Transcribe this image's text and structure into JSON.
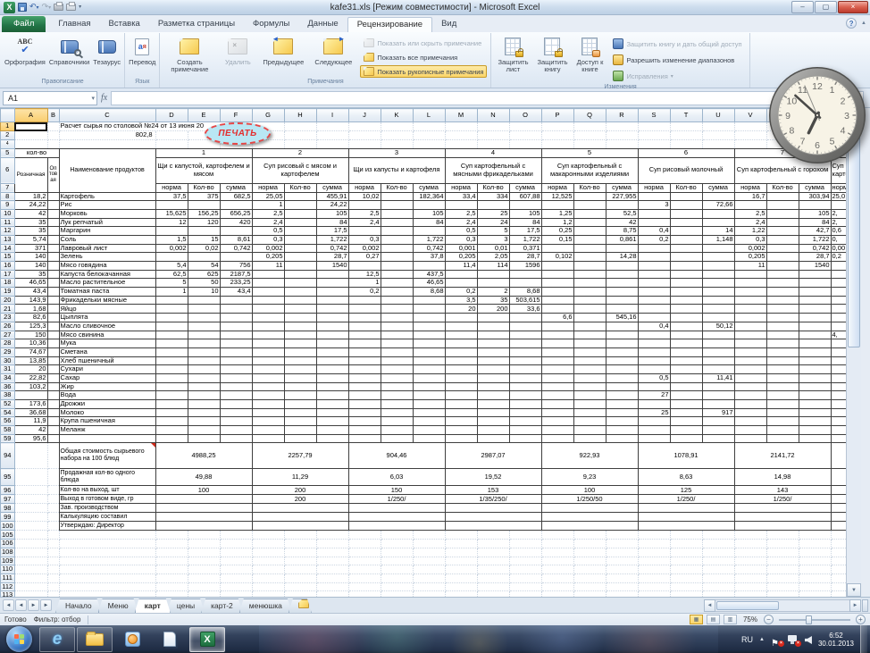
{
  "window": {
    "title": "kafe31.xls  [Режим совместимости]  -  Microsoft Excel"
  },
  "glyphs": {
    "min": "–",
    "max": "▢",
    "close": "×",
    "dd": "▾",
    "undo": "↶",
    "redo": "↷",
    "abc": "ABC",
    "check": "✔",
    "a": "а",
    "ya": "я",
    "up": "▲",
    "down": "▼",
    "left": "◄",
    "right": "►",
    "first": "◄◄",
    "last": "►►",
    "help": "?",
    "chev": "▲",
    "minus": "−",
    "plus": "+",
    "fx": "fx",
    "flag": "⚑",
    "x": "×",
    "ie": "e",
    "excel": "X"
  },
  "tabs": {
    "file": "Файл",
    "items": [
      "Главная",
      "Вставка",
      "Разметка страницы",
      "Формулы",
      "Данные",
      "Рецензирование",
      "Вид"
    ]
  },
  "ribbon": {
    "group_labels": [
      "Правописание",
      "Язык",
      "Примечания",
      "Изменения"
    ],
    "spelling": "Орфография",
    "reference": "Справочники",
    "thesaurus": "Тезаурус",
    "translate": "Перевод",
    "new_comment": "Создать примечание",
    "delete_comment": "Удалить",
    "previous": "Предыдущее",
    "next": "Следующее",
    "toggle_show_hide": "Показать или скрыть примечание",
    "toggle_show_all": "Показать все примечания",
    "toggle_show_ink": "Показать рукописные примечания",
    "protect_sheet": "Защитить лист",
    "protect_book": "Защитить книгу",
    "share_book": "Доступ к книге",
    "protect_share": "Защитить книгу и дать общий доступ",
    "allow_ranges": "Разрешить изменение диапазонов",
    "track_changes": "Исправления"
  },
  "formula_bar": {
    "name_box": "A1",
    "formula": ""
  },
  "sheet": {
    "columns": [
      "A",
      "B",
      "C",
      "D",
      "E",
      "F",
      "G",
      "H",
      "I",
      "J",
      "K",
      "L",
      "M",
      "N",
      "O",
      "P",
      "Q",
      "R",
      "S",
      "T",
      "U",
      "V",
      "W",
      "X",
      "Y"
    ],
    "title1": "Расчет сырья по столовой №24 от 13 июня 20",
    "title2": "802,8",
    "print_button": "ПЕЧАТЬ",
    "hdr_kolvo": "кол-во",
    "hdr_retail": "Розничная",
    "hdr_opt": "Оптовая",
    "hdr_name": "Наименование продуктов",
    "subcols": [
      "норма",
      "Кол-во",
      "сумма"
    ],
    "dishes": [
      {
        "num": "1",
        "name": "Щи с капустой, картофелем и мясом"
      },
      {
        "num": "2",
        "name": "Суп рисовый с мясом и картофелем"
      },
      {
        "num": "3",
        "name": "Щи из капусты и картофеля"
      },
      {
        "num": "4",
        "name": "Суп картофельный с мясными фрикадельками"
      },
      {
        "num": "5",
        "name": "Суп картофельный с макаронными изделиями"
      },
      {
        "num": "6",
        "name": "Суп рисовый молочный"
      },
      {
        "num": "7",
        "name": "Суп картофельный с горохом"
      }
    ],
    "dish_partial": "Суп картоф",
    "sub_partial": "норма",
    "rows": [
      {
        "n": "8",
        "a": "18,2",
        "c": "Картофель",
        "v": {
          "D": "37,5",
          "E": "375",
          "F": "682,5",
          "G": "25,05",
          "I": "455,91",
          "J": "10,02",
          "L": "182,364",
          "M": "33,4",
          "N": "334",
          "O": "607,88",
          "P": "12,525",
          "R": "227,955",
          "V": "16,7",
          "X": "303,94",
          "Y": "25,0"
        }
      },
      {
        "n": "9",
        "a": "24,22",
        "c": "Рис",
        "v": {
          "G": "1",
          "I": "24,22",
          "S": "3",
          "U": "72,66"
        }
      },
      {
        "n": "10",
        "a": "42",
        "c": "Морковь",
        "v": {
          "D": "15,625",
          "E": "156,25",
          "F": "656,25",
          "G": "2,5",
          "I": "105",
          "J": "2,5",
          "L": "105",
          "M": "2,5",
          "N": "25",
          "O": "105",
          "P": "1,25",
          "R": "52,5",
          "V": "2,5",
          "X": "105",
          "Y": "2,"
        }
      },
      {
        "n": "11",
        "a": "35",
        "c": "Лук репчатый",
        "v": {
          "D": "12",
          "E": "120",
          "F": "420",
          "G": "2,4",
          "I": "84",
          "J": "2,4",
          "L": "84",
          "M": "2,4",
          "N": "24",
          "O": "84",
          "P": "1,2",
          "R": "42",
          "V": "2,4",
          "X": "84",
          "Y": "2,"
        }
      },
      {
        "n": "12",
        "a": "35",
        "c": "Маргарин",
        "v": {
          "G": "0,5",
          "I": "17,5",
          "M": "0,5",
          "N": "5",
          "O": "17,5",
          "P": "0,25",
          "R": "8,75",
          "S": "0,4",
          "U": "14",
          "V": "1,22",
          "X": "42,7",
          "Y": "0,6"
        }
      },
      {
        "n": "13",
        "a": "5,74",
        "c": "Соль",
        "v": {
          "D": "1,5",
          "E": "15",
          "F": "8,61",
          "G": "0,3",
          "I": "1,722",
          "J": "0,3",
          "L": "1,722",
          "M": "0,3",
          "N": "3",
          "O": "1,722",
          "P": "0,15",
          "R": "0,861",
          "S": "0,2",
          "U": "1,148",
          "V": "0,3",
          "X": "1,722",
          "Y": "0,"
        }
      },
      {
        "n": "14",
        "a": "371",
        "c": "Лавровый лист",
        "v": {
          "D": "0,002",
          "E": "0,02",
          "F": "0,742",
          "G": "0,002",
          "I": "0,742",
          "J": "0,002",
          "L": "0,742",
          "M": "0,001",
          "N": "0,01",
          "O": "0,371",
          "V": "0,002",
          "X": "0,742",
          "Y": "0,00"
        }
      },
      {
        "n": "15",
        "a": "140",
        "c": "Зелень",
        "v": {
          "G": "0,205",
          "I": "28,7",
          "J": "0,27",
          "L": "37,8",
          "M": "0,205",
          "N": "2,05",
          "O": "28,7",
          "P": "0,102",
          "R": "14,28",
          "V": "0,205",
          "X": "28,7",
          "Y": "0,2"
        }
      },
      {
        "n": "16",
        "a": "140",
        "c": "Мясо говядина",
        "v": {
          "D": "5,4",
          "E": "54",
          "F": "756",
          "G": "11",
          "I": "1540",
          "M": "11,4",
          "N": "114",
          "O": "1596",
          "V": "11",
          "X": "1540"
        }
      },
      {
        "n": "17",
        "a": "35",
        "c": "Капуста белокачанная",
        "v": {
          "D": "62,5",
          "E": "625",
          "F": "2187,5",
          "J": "12,5",
          "L": "437,5"
        }
      },
      {
        "n": "18",
        "a": "46,65",
        "c": "Масло растительное",
        "v": {
          "D": "5",
          "E": "50",
          "F": "233,25",
          "J": "1",
          "L": "46,65"
        }
      },
      {
        "n": "19",
        "a": "43,4",
        "c": "Томатная паста",
        "v": {
          "D": "1",
          "E": "10",
          "F": "43,4",
          "J": "0,2",
          "L": "8,68",
          "M": "0,2",
          "N": "2",
          "O": "8,68"
        }
      },
      {
        "n": "20",
        "a": "143,9",
        "c": "Фрикадельки мясные",
        "v": {
          "M": "3,5",
          "N": "35",
          "O": "503,615"
        }
      },
      {
        "n": "21",
        "a": "1,68",
        "c": "Яйцо",
        "v": {
          "M": "20",
          "N": "200",
          "O": "33,6"
        }
      },
      {
        "n": "23",
        "a": "82,6",
        "c": "Цыплята",
        "v": {
          "P": "6,6",
          "R": "545,16"
        }
      },
      {
        "n": "26",
        "a": "125,3",
        "c": "Масло сливочное",
        "v": {
          "S": "0,4",
          "U": "50,12"
        }
      },
      {
        "n": "27",
        "a": "150",
        "c": "Мясо свинина",
        "v": {
          "Y": "4,"
        }
      },
      {
        "n": "28",
        "a": "10,36",
        "c": "Мука",
        "v": {}
      },
      {
        "n": "29",
        "a": "74,67",
        "c": "Сметана",
        "v": {}
      },
      {
        "n": "30",
        "a": "13,85",
        "c": "Хлеб пшеничный",
        "v": {}
      },
      {
        "n": "31",
        "a": "20",
        "c": "Сухари",
        "v": {}
      },
      {
        "n": "34",
        "a": "22,82",
        "c": "Сахар",
        "v": {
          "S": "0,5",
          "U": "11,41"
        }
      },
      {
        "n": "36",
        "a": "103,2",
        "c": "Жир",
        "v": {}
      },
      {
        "n": "38",
        "a": "",
        "c": "Вода",
        "v": {
          "S": "27"
        }
      },
      {
        "n": "52",
        "a": "173,6",
        "c": "Дрожжи",
        "v": {}
      },
      {
        "n": "54",
        "a": "36,68",
        "c": "Молоко",
        "v": {
          "S": "25",
          "U": "917"
        }
      },
      {
        "n": "56",
        "a": "11,9",
        "c": "Крупа пшеничная",
        "v": {}
      },
      {
        "n": "58",
        "a": "42",
        "c": "Меланж",
        "v": {}
      },
      {
        "n": "59",
        "a": "95,6",
        "c": "",
        "v": {}
      }
    ],
    "summary_rows": [
      {
        "n": "94",
        "h": 29,
        "label": "Общая стоимость сырьевого набора на 100 блюд",
        "vals": [
          "4988,25",
          "2257,79",
          "904,46",
          "2987,07",
          "922,93",
          "1078,91",
          "2141,72"
        ]
      },
      {
        "n": "95",
        "h": 19,
        "label": "Продажная кол-во одного блюда",
        "vals": [
          "49,88",
          "11,29",
          "6,03",
          "19,52",
          "9,23",
          "8,63",
          "14,98"
        ]
      },
      {
        "n": "96",
        "h": 10,
        "label": "Кол-во на выход, шт",
        "vals": [
          "100",
          "200",
          "150",
          "153",
          "100",
          "125",
          "143"
        ]
      },
      {
        "n": "97",
        "h": 10,
        "label": "Выход в готовом виде, гр",
        "vals": [
          "",
          "200",
          "1/250/",
          "1/35/250/",
          "1/250/50",
          "1/250/",
          "1/250/"
        ]
      },
      {
        "n": "98",
        "h": 10,
        "label": "Зав. производством",
        "vals": [
          "",
          "",
          "",
          "",
          "",
          "",
          ""
        ]
      },
      {
        "n": "99",
        "h": 10,
        "label": "Калькуляцию составил",
        "vals": [
          "",
          "",
          "",
          "",
          "",
          "",
          ""
        ]
      },
      {
        "n": "100",
        "h": 10,
        "label": "Утверждаю: Директор",
        "vals": [
          "",
          "",
          "",
          "",
          "",
          "",
          ""
        ]
      }
    ],
    "empty_rows": [
      "105",
      "106",
      "108",
      "109",
      "110",
      "111",
      "112",
      "113"
    ]
  },
  "sheet_tabs": {
    "items": [
      "Начало",
      "Меню",
      "карт",
      "цены",
      "карт-2",
      "менюшка"
    ],
    "active_index": 2
  },
  "status_bar": {
    "ready": "Готово",
    "filter": "Фильтр: отбор",
    "zoom": "75%"
  },
  "taskbar": {
    "lang": "RU",
    "time": "6:52",
    "date": "30.01.2013"
  },
  "clock": {
    "numbers": [
      "1",
      "2",
      "3",
      "4",
      "5",
      "6",
      "7",
      "8",
      "9",
      "10",
      "11",
      "12"
    ],
    "hour_deg": 206,
    "minute_deg": 312,
    "second_deg": 337
  }
}
